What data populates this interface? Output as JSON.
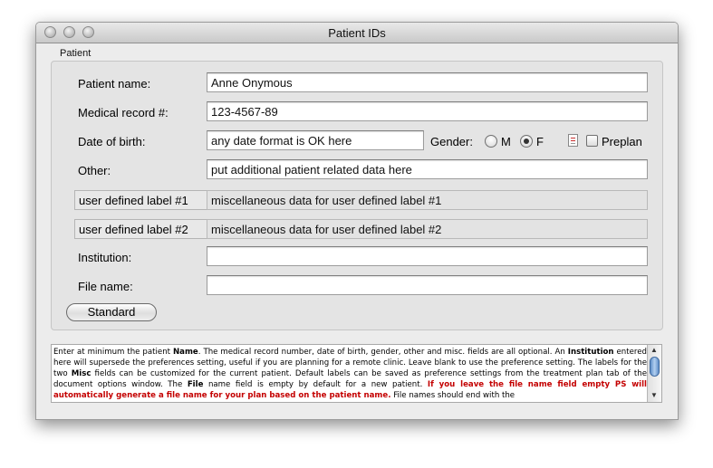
{
  "window": {
    "title": "Patient IDs"
  },
  "group": {
    "title": "Patient"
  },
  "form": {
    "patient_name": {
      "label": "Patient name:",
      "value": "Anne Onymous"
    },
    "medical_record": {
      "label": "Medical record #:",
      "value": "123-4567-89"
    },
    "date_of_birth": {
      "label": "Date of birth:",
      "value": "any date format is OK here"
    },
    "gender": {
      "label": "Gender:",
      "options": [
        "M",
        "F"
      ],
      "selected": "F"
    },
    "preplan": {
      "label": "Preplan",
      "checked": false
    },
    "other": {
      "label": "Other:",
      "value": "put additional patient related data here"
    },
    "misc1": {
      "label": "user defined label #1",
      "value": "miscellaneous data for user defined label #1"
    },
    "misc2": {
      "label": "user defined label #2",
      "value": "miscellaneous data for user defined label #2"
    },
    "institution": {
      "label": "Institution:",
      "value": ""
    },
    "file_name": {
      "label": "File name:",
      "value": ""
    },
    "standard_button": "Standard"
  },
  "help": {
    "p1": "Enter at minimum the patient ",
    "b1": "Name",
    "p2": ". The medical record number, date of birth, gender, other and misc. fields are all optional. An ",
    "b2": "Institution",
    "p3": " entered here will supersede the preferences setting, useful if you are planning for a remote clinic. Leave blank to use the preference setting. The labels for the two ",
    "b3": "Misc",
    "p4": " fields can be customized for the current patient. Default labels can be saved as preference settings from the treatment plan tab of the document options window. The ",
    "b4": "File",
    "p5": " name field is empty by default for a new patient. ",
    "red1": "If you leave the file name field empty PS will automatically generate a file name for your plan based on the patient name.",
    "p6": " File names should end with the"
  },
  "scroll": {
    "up_icon": "triangle-up-icon",
    "down_icon": "triangle-down-icon"
  }
}
